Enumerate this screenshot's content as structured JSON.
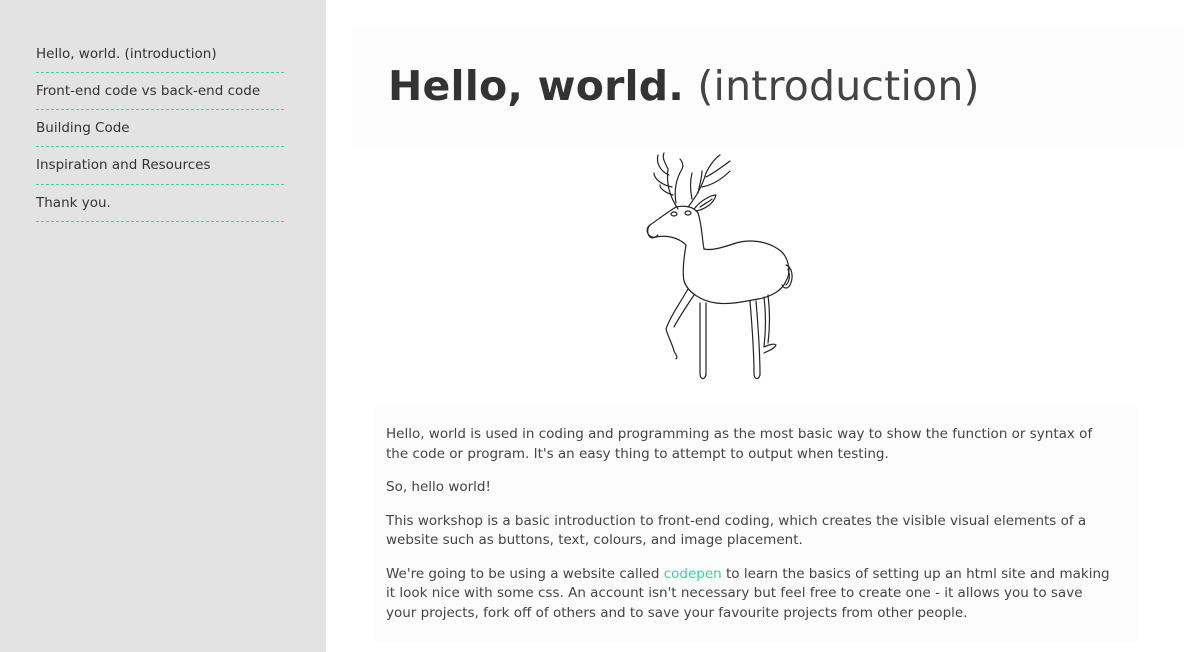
{
  "sidebar": {
    "items": [
      {
        "label": "Hello, world. (introduction)"
      },
      {
        "label": "Front-end code vs back-end code"
      },
      {
        "label": "Building Code"
      },
      {
        "label": "Inspiration and Resources"
      },
      {
        "label": "Thank you."
      }
    ]
  },
  "header": {
    "title_main": "Hello, world.",
    "title_sub": "(introduction)"
  },
  "illustration": {
    "icon": "deer-illustration"
  },
  "content": {
    "p1": "Hello, world is used in coding and programming as the most basic way to show the function or syntax of the code or program. It's an easy thing to attempt to output when testing.",
    "p2": "So, hello world!",
    "p3": "This workshop is a basic introduction to front-end coding, which creates the visible visual elements of a website such as buttons, text, colours, and image placement.",
    "p4_before": "We're going to be using a website called ",
    "p4_link": "codepen",
    "p4_after": " to learn the basics of setting up an html site and making it look nice with some css. An account isn't necessary but feel free to create one - it allows you to save your projects, fork off of others and to save your favourite projects from other people."
  },
  "colors": {
    "sidebar_bg": "#e3e3e3",
    "accent": "#3ad29f",
    "text": "#333333"
  }
}
